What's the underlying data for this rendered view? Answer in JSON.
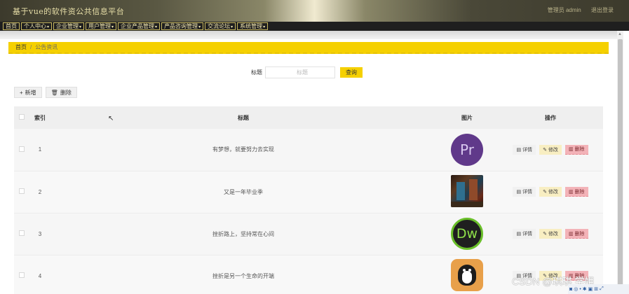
{
  "header": {
    "site_title": "基于vue的软件资公共信息平台",
    "user_role": "管理员 admin",
    "logout": "退出登录"
  },
  "nav": [
    {
      "label": "首页",
      "has_dropdown": false
    },
    {
      "label": "个人中心",
      "has_dropdown": true
    },
    {
      "label": "企业管理",
      "has_dropdown": true
    },
    {
      "label": "用户管理",
      "has_dropdown": true
    },
    {
      "label": "企业产品管理",
      "has_dropdown": true
    },
    {
      "label": "产品咨询管理",
      "has_dropdown": true
    },
    {
      "label": "交流论坛",
      "has_dropdown": true
    },
    {
      "label": "系统管理",
      "has_dropdown": true
    }
  ],
  "breadcrumb": {
    "home": "首页",
    "current": "公告资讯"
  },
  "search": {
    "label": "标题",
    "placeholder": "标题",
    "button": "查询"
  },
  "actions": {
    "add": "新增",
    "delete": "删除"
  },
  "table": {
    "headers": {
      "index": "索引",
      "title": "标题",
      "image": "图片",
      "ops": "操作"
    },
    "rows": [
      {
        "index": "1",
        "title": "有梦想，就要努力去实现",
        "image": "pr-logo-icon"
      },
      {
        "index": "2",
        "title": "又是一年毕业季",
        "image": "photo-thumbnail"
      },
      {
        "index": "3",
        "title": "挫折路上，坚持常在心间",
        "image": "dw-logo-icon"
      },
      {
        "index": "4",
        "title": "挫折是另一个生命的开端",
        "image": "penguin-logo-icon"
      }
    ],
    "op_labels": {
      "detail": "详情",
      "edit": "修改",
      "delete": "删除"
    }
  },
  "logos": {
    "pr": "Pr",
    "dw": "Dw"
  },
  "watermark": "CSDN @琪琪 学姐",
  "colors": {
    "accent": "#f5d000",
    "danger": "#f3b3b8",
    "edit": "#f8eec2",
    "pr": "#60398a",
    "dw_ring": "#6abf2a"
  }
}
